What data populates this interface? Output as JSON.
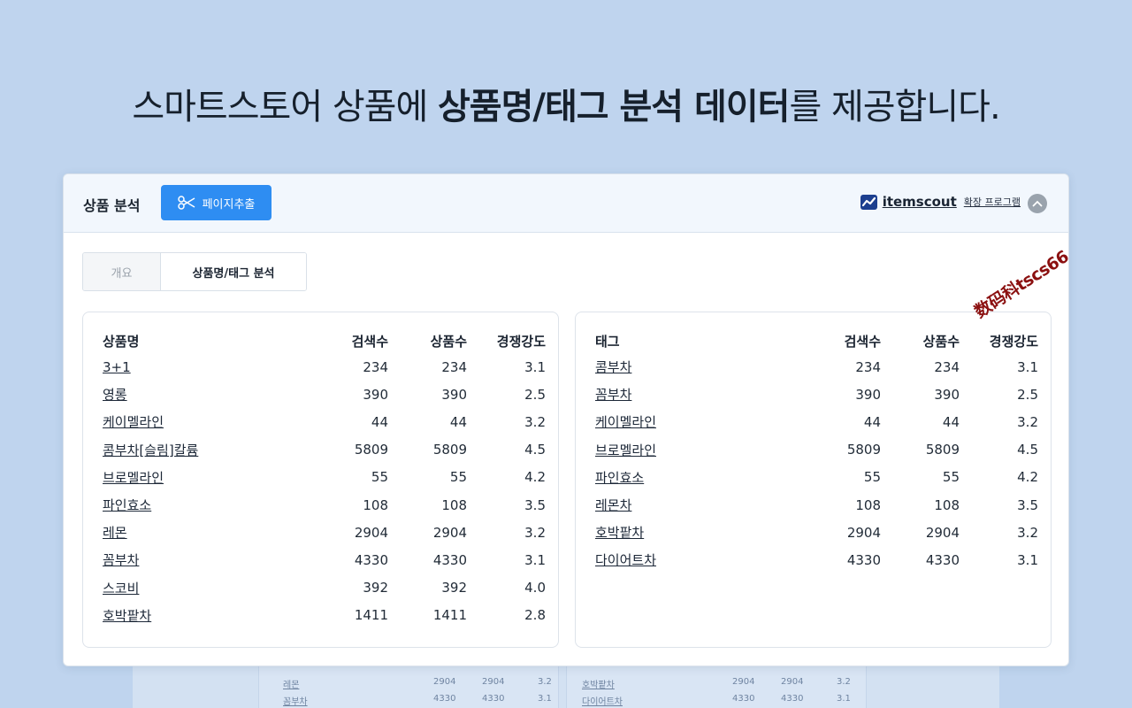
{
  "headline": {
    "prefix": "스마트스토어 상품에 ",
    "bold": "상품명/태그 분석 데이터",
    "suffix": "를 제공합니다."
  },
  "panel": {
    "title": "상품 분석",
    "extract_button": "페이지추출",
    "brand_name": "itemscout",
    "brand_sub": "확장 프로그램",
    "accent_color": "#2e8df2"
  },
  "tabs": [
    {
      "label": "개요",
      "active": false
    },
    {
      "label": "상품명/태그 분석",
      "active": true
    }
  ],
  "product_table": {
    "headers": [
      "상품명",
      "검색수",
      "상품수",
      "경쟁강도"
    ],
    "rows": [
      [
        "3+1",
        "234",
        "234",
        "3.1"
      ],
      [
        "영롱",
        "390",
        "390",
        "2.5"
      ],
      [
        "케이멜라인",
        "44",
        "44",
        "3.2"
      ],
      [
        "콤부차[슬림]칼륨",
        "5809",
        "5809",
        "4.5"
      ],
      [
        "브로멜라인",
        "55",
        "55",
        "4.2"
      ],
      [
        "파인효소",
        "108",
        "108",
        "3.5"
      ],
      [
        "레몬",
        "2904",
        "2904",
        "3.2"
      ],
      [
        "꼼부차",
        "4330",
        "4330",
        "3.1"
      ],
      [
        "스코비",
        "392",
        "392",
        "4.0"
      ],
      [
        "호박팥차",
        "1411",
        "1411",
        "2.8"
      ]
    ]
  },
  "tag_table": {
    "headers": [
      "태그",
      "검색수",
      "상품수",
      "경쟁강도"
    ],
    "rows": [
      [
        "콤부차",
        "234",
        "234",
        "3.1"
      ],
      [
        "꼼부차",
        "390",
        "390",
        "2.5"
      ],
      [
        "케이멜라인",
        "44",
        "44",
        "3.2"
      ],
      [
        "브로멜라인",
        "5809",
        "5809",
        "4.5"
      ],
      [
        "파인효소",
        "55",
        "55",
        "4.2"
      ],
      [
        "레몬차",
        "108",
        "108",
        "3.5"
      ],
      [
        "호박팥차",
        "2904",
        "2904",
        "3.2"
      ],
      [
        "다이어트차",
        "4330",
        "4330",
        "3.1"
      ]
    ]
  },
  "ghost_rows": [
    [
      "레몬",
      "2904",
      "2904",
      "3.2",
      "호박팥차",
      "2904",
      "2904",
      "3.2"
    ],
    [
      "꼼부차",
      "4330",
      "4330",
      "3.1",
      "다이어트차",
      "4330",
      "4330",
      "3.1"
    ]
  ],
  "watermark": "数码科tscs66"
}
